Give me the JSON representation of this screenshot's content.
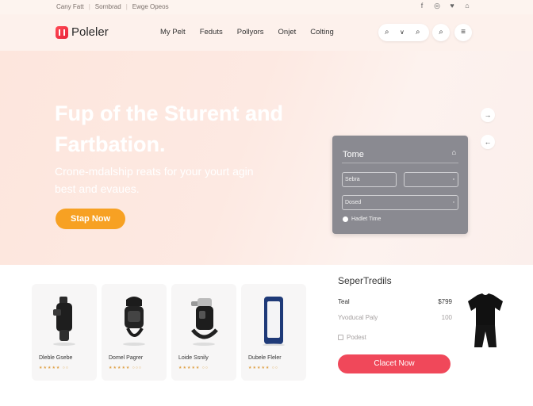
{
  "topbar": {
    "links": [
      "Cany Fatt",
      "Sornbrad",
      "Ewge Opeos"
    ],
    "social_icons": [
      "facebook-icon",
      "instagram-icon",
      "twitter-icon",
      "cart-icon"
    ]
  },
  "header": {
    "logo": "Poleler",
    "nav": [
      "My Pelt",
      "Feduts",
      "Pollyors",
      "Onjet",
      "Colting"
    ],
    "icons": [
      "search-icon",
      "chevron-down-icon",
      "search-icon",
      "search-icon",
      "menu-icon"
    ]
  },
  "hero": {
    "title": "Fup of the Sturent and Fartbation.",
    "subtitle": "Crone-mdalship reats for your yourt agin best and evaues.",
    "cta": "Stap Now"
  },
  "form": {
    "title": "Tome",
    "field1": "Sebra",
    "field2": "",
    "field3": "Dosed",
    "radio_label": "Hadlet Time"
  },
  "products": [
    {
      "name": "Dleble Gsebe",
      "stars": "★★★★★ ○○"
    },
    {
      "name": "Domel Pagrer",
      "stars": "★★★★★ ○○○"
    },
    {
      "name": "Loide Ssnily",
      "stars": "★★★★★ ○○"
    },
    {
      "name": "Dubele Fleler",
      "stars": "★★★★★ ○○"
    }
  ],
  "summary": {
    "title": "SeperTredils",
    "row1_label": "Teal",
    "row1_value": "$799",
    "row2_label": "Yvoducal Paly",
    "row2_value": "100",
    "checkbox_label": "Podest",
    "checkout": "Clacet Now"
  },
  "colors": {
    "accent_orange": "#f7a123",
    "accent_red": "#f0485a",
    "card_gray": "#8a8a91"
  }
}
